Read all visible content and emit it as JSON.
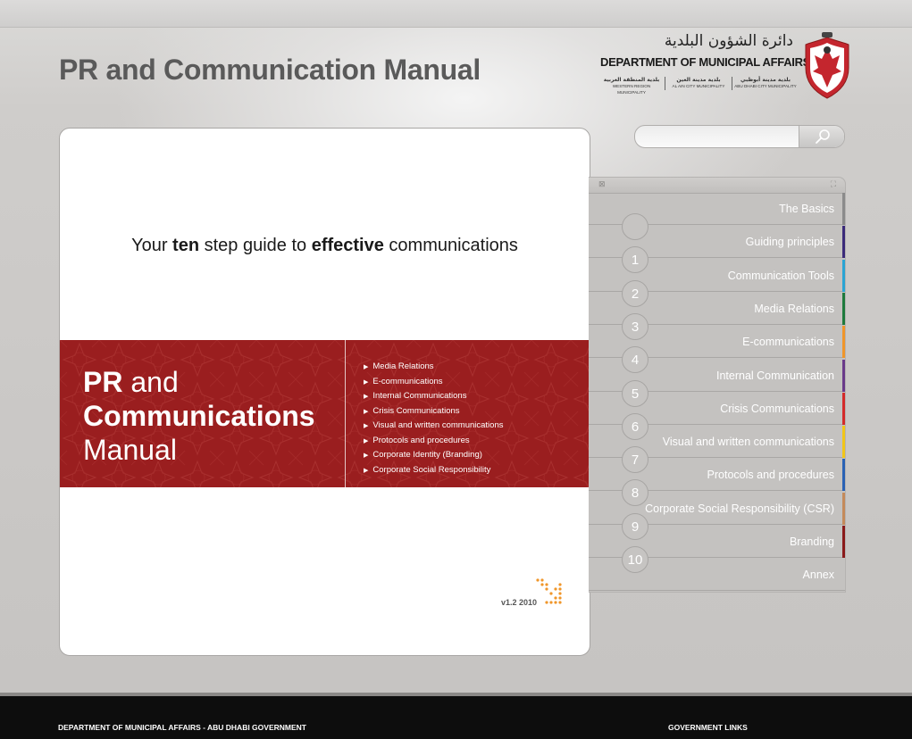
{
  "header": {
    "title": "PR and Communication Manual",
    "logo": {
      "arabic_title": "دائرة الشؤون البلدية",
      "department": "DEPARTMENT OF MUNICIPAL AFFAIRS",
      "municipalities": [
        {
          "ar": "بلدية المنطقة الغربية",
          "en": "WESTERN REGION MUNICIPALITY"
        },
        {
          "ar": "بلدية مدينة العين",
          "en": "AL AIN CITY MUNICIPALITY"
        },
        {
          "ar": "بلدية مدينة أبوظبي",
          "en": "ABU DHABI CITY MUNICIPALITY"
        }
      ],
      "emblem_icon": "falcon-emblem-icon",
      "emblem_color": "#c4262e"
    }
  },
  "search": {
    "placeholder": "",
    "value": "",
    "icon": "search-icon"
  },
  "cover": {
    "tagline": {
      "part1": "Your ",
      "bold1": "ten",
      "part2": " step guide to ",
      "bold2": "effective",
      "part3": " communications"
    },
    "banner": {
      "title_pr": "PR",
      "title_and": " and",
      "title_comm": "Communications",
      "title_manual": "Manual",
      "items": [
        "Media Relations",
        "E-communications",
        "Internal Communications",
        "Crisis Communications",
        "Visual and written communications",
        "Protocols and procedures",
        "Corporate Identity (Branding)",
        "Corporate Social Responsibility"
      ],
      "color": "#9a1e1f"
    },
    "version": "v1.2 2010",
    "accent_color": "#f0962a"
  },
  "nav": {
    "items": [
      {
        "label": "The Basics",
        "color": "#8b8b8b"
      },
      {
        "label": "Guiding principles",
        "color": "#3b2a7a"
      },
      {
        "label": "Communication Tools",
        "color": "#2aa4d4"
      },
      {
        "label": "Media Relations",
        "color": "#1e7a3c"
      },
      {
        "label": "E-communications",
        "color": "#f0962a"
      },
      {
        "label": "Internal Communication",
        "color": "#6a3a8a"
      },
      {
        "label": "Crisis Communications",
        "color": "#d42a2a"
      },
      {
        "label": "Visual and written communications",
        "color": "#f2c618"
      },
      {
        "label": "Protocols and procedures",
        "color": "#2a62b4"
      },
      {
        "label": "Corporate Social Responsibility (CSR)",
        "color": "#c48a5a"
      },
      {
        "label": "Branding",
        "color": "#8a1a1a"
      },
      {
        "label": "Annex",
        "color": ""
      }
    ],
    "numbers": [
      "1",
      "2",
      "3",
      "4",
      "5",
      "6",
      "7",
      "8",
      "9",
      "10"
    ]
  },
  "footer": {
    "left": "DEPARTMENT OF MUNICIPAL AFFAIRS - ABU DHABI GOVERNMENT",
    "right": "GOVERNMENT LINKS"
  }
}
